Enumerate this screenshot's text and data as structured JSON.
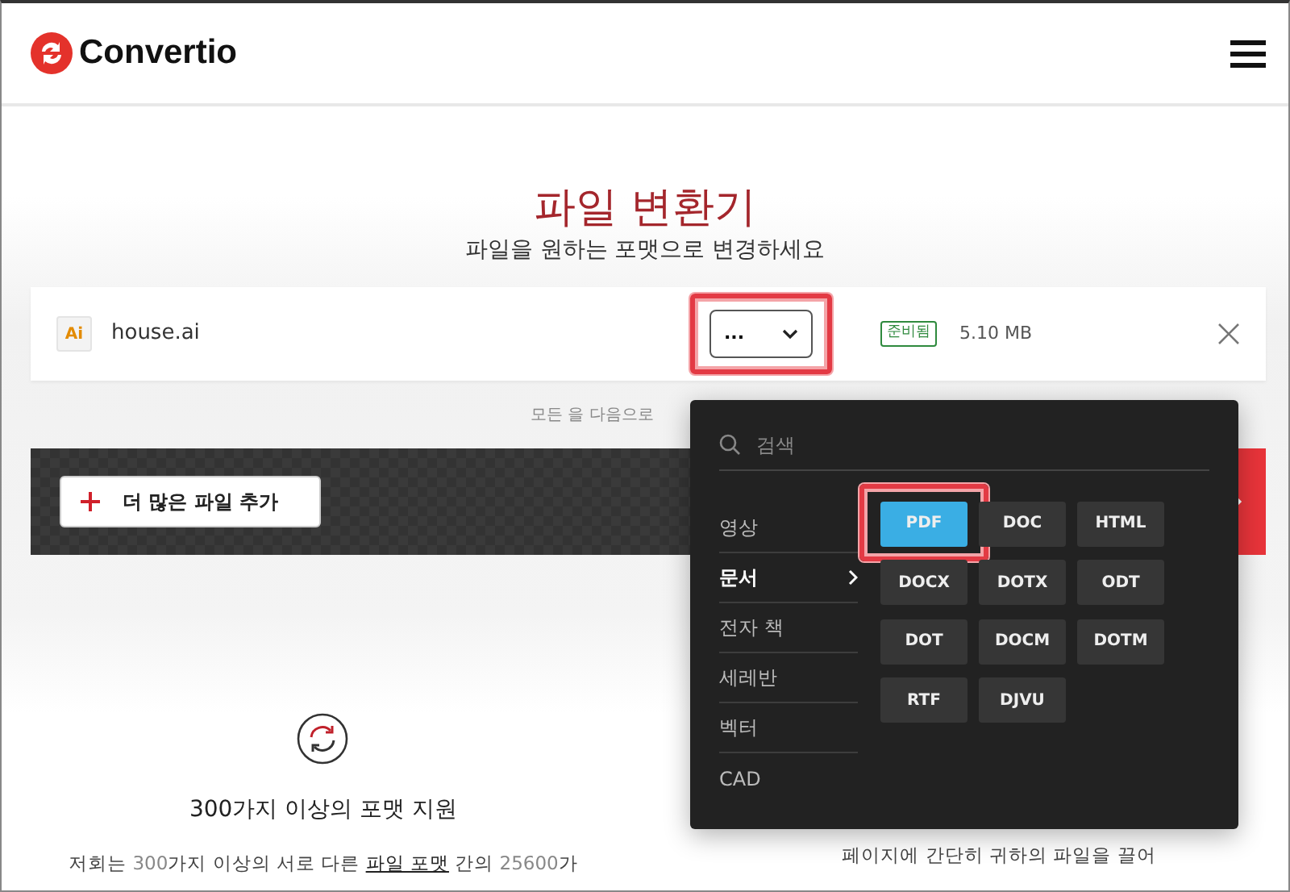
{
  "header": {
    "brand": "Convertio"
  },
  "hero": {
    "title": "파일 변환기",
    "subtitle": "파일을 원하는 포맷으로 변경하세요"
  },
  "file": {
    "type_badge": "Ai",
    "name": "house.ai",
    "target": "...",
    "target_highlighted": true,
    "status": "준비됨",
    "size": "5.10 MB"
  },
  "convert_all_text": "모든 을 다음으로",
  "add_button": "더 많은 파일 추가",
  "format_menu": {
    "search_placeholder": "검색",
    "categories": [
      {
        "label": "영상",
        "selected": false
      },
      {
        "label": "문서",
        "selected": true
      },
      {
        "label": "전자 책",
        "selected": false
      },
      {
        "label": "세레반",
        "selected": false
      },
      {
        "label": "벡터",
        "selected": false
      },
      {
        "label": "CAD",
        "selected": false
      }
    ],
    "formats": [
      {
        "label": "PDF",
        "selected": true,
        "highlighted": true
      },
      {
        "label": "DOC",
        "selected": false,
        "highlighted": false
      },
      {
        "label": "HTML",
        "selected": false,
        "highlighted": false
      },
      {
        "label": "DOCX",
        "selected": false,
        "highlighted": false
      },
      {
        "label": "DOTX",
        "selected": false,
        "highlighted": false
      },
      {
        "label": "ODT",
        "selected": false,
        "highlighted": false
      },
      {
        "label": "DOT",
        "selected": false,
        "highlighted": false
      },
      {
        "label": "DOCM",
        "selected": false,
        "highlighted": false
      },
      {
        "label": "DOTM",
        "selected": false,
        "highlighted": false
      },
      {
        "label": "RTF",
        "selected": false,
        "highlighted": false
      },
      {
        "label": "DJVU",
        "selected": false,
        "highlighted": false
      }
    ]
  },
  "features": [
    {
      "title": "300가지 이상의 포맷 지원",
      "description": "저회는 **300**가지 이상의 서로 다른 ",
      "link": "파일 포맷",
      "description_end": " 간의 **25600**가"
    },
    {
      "description": "페이지에 간단히 귀하의 파일을 끌어"
    }
  ]
}
